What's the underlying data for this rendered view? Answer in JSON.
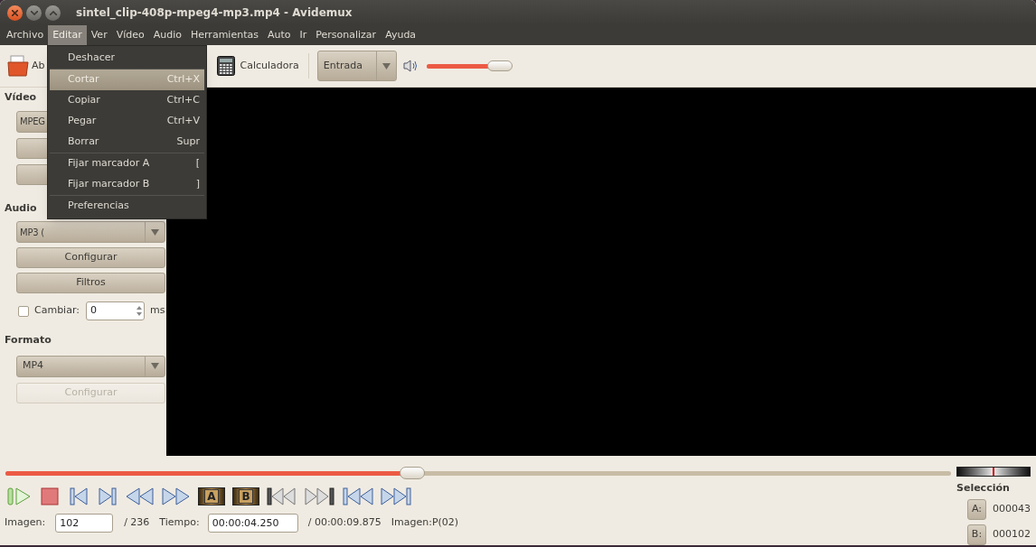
{
  "window": {
    "title": "sintel_clip-408p-mpeg4-mp3.mp4 - Avidemux"
  },
  "menu_bar": [
    {
      "label": "Archivo",
      "selected": false
    },
    {
      "label": "Editar",
      "selected": true
    },
    {
      "label": "Ver",
      "selected": false
    },
    {
      "label": "Vídeo",
      "selected": false
    },
    {
      "label": "Audio",
      "selected": false
    },
    {
      "label": "Herramientas",
      "selected": false
    },
    {
      "label": "Auto",
      "selected": false
    },
    {
      "label": "Ir",
      "selected": false
    },
    {
      "label": "Personalizar",
      "selected": false
    },
    {
      "label": "Ayuda",
      "selected": false
    }
  ],
  "edit_menu": [
    [
      {
        "label": "Deshacer",
        "selected": false
      }
    ],
    [
      {
        "label": "Cortar",
        "shortcut": "Ctrl+X",
        "selected": true
      },
      {
        "label": "Copiar",
        "shortcut": "Ctrl+C",
        "selected": false
      },
      {
        "label": "Pegar",
        "shortcut": "Ctrl+V",
        "selected": false
      },
      {
        "label": "Borrar",
        "shortcut": "Supr",
        "selected": false
      }
    ],
    [
      {
        "label": "Fijar marcador A",
        "shortcut": "[",
        "selected": false
      },
      {
        "label": "Fijar marcador B",
        "shortcut": "]",
        "selected": false
      }
    ],
    [
      {
        "label": "Preferencias",
        "selected": false
      }
    ]
  ],
  "toolbar": {
    "open_label": "Ab",
    "calculator_label": "Calculadora",
    "source_combo": "Entrada",
    "volume": {
      "level": 0.86
    }
  },
  "sidebar": {
    "video": {
      "heading": "Vídeo",
      "codec": "MPEG"
    },
    "audio": {
      "heading": "Audio",
      "codec": "MP3 (",
      "configure": "Configurar",
      "filters": "Filtros",
      "shift": {
        "label": "Cambiar:",
        "checked": false,
        "value": "0",
        "unit": "ms"
      }
    },
    "format": {
      "heading": "Formato",
      "container": "MP4",
      "configure": {
        "label": "Configurar",
        "disabled": true
      }
    }
  },
  "seek": {
    "level": 0.43
  },
  "marker_labels": [
    "A",
    "B"
  ],
  "status": {
    "frame_label": "Imagen:",
    "frame": "102",
    "frame_total": "/ 236",
    "time_label": "Tiempo:",
    "time": "00:00:04.250",
    "time_total": "/ 00:00:09.875",
    "frame_type": "Imagen:P(02)"
  },
  "selection": {
    "heading": "Selección",
    "a_label": "A:",
    "a_value": "000043",
    "b_label": "B:",
    "b_value": "000102"
  }
}
